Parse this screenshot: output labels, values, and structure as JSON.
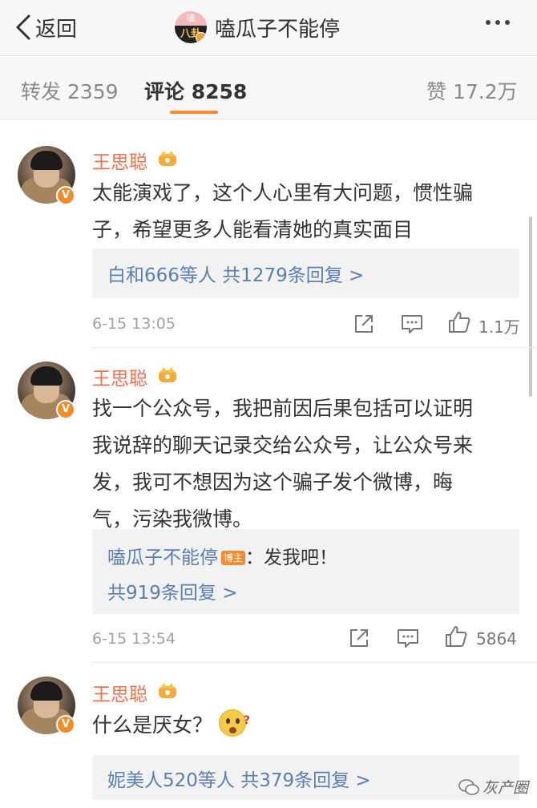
{
  "topbar": {
    "back_label": "返回",
    "title": "嗑瓜子不能停",
    "avatar_top_text": "嗑",
    "avatar_bottom_text": "八卦"
  },
  "tabs": [
    {
      "label": "转发 2359",
      "active": false
    },
    {
      "label": "评论 8258",
      "active": true
    },
    {
      "label": "赞 17.2万",
      "active": false
    }
  ],
  "comments": [
    {
      "user": "王思聪",
      "verified": "V",
      "text_lines": [
        "太能演戏了，这个人心里有大问题，惯性骗",
        "子，希望更多人能看清她的真实面目"
      ],
      "reply_summary": "白和666等人 共1279条回复 >",
      "time": "6-15 13:05",
      "likes": "1.1万"
    },
    {
      "user": "王思聪",
      "verified": "V",
      "text_lines": [
        "找一个公众号，我把前因后果包括可以证明",
        "我说辞的聊天记录交给公众号，让公众号来",
        "发，我可不想因为这个骗子发个微博，晦",
        "气，污染我微博。"
      ],
      "reply_author": "嗑瓜子不能停",
      "reply_badge": "博主",
      "reply_text": "：发我吧！",
      "reply_summary": "共919条回复 >",
      "time": "6-15 13:54",
      "likes": "5864"
    },
    {
      "user": "王思聪",
      "verified": "V",
      "text_lines": [
        "什么是厌女？"
      ],
      "reply_summary": "妮美人520等人 共379条回复 >"
    }
  ],
  "watermark": "灰产圈",
  "colors": {
    "username": "#eb7350",
    "link": "#5a7eb3",
    "tab_underline": "#f8892a",
    "verified_badge": "#f28c28"
  },
  "icons": [
    "chevron-left-icon",
    "more-dots-icon",
    "crown-icon",
    "share-icon",
    "comment-icon",
    "like-icon",
    "wechat-icon",
    "question-emoji-icon"
  ]
}
